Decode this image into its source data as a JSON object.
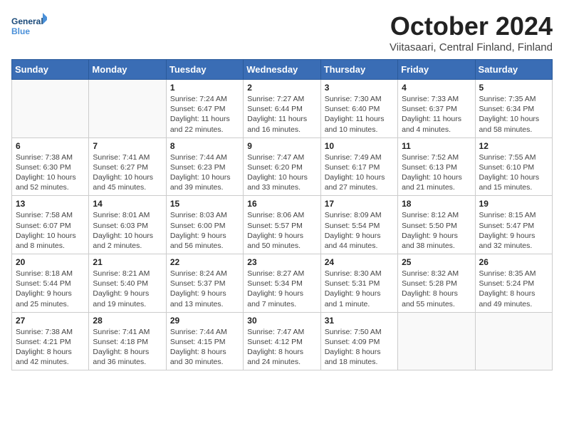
{
  "header": {
    "logo_general": "General",
    "logo_blue": "Blue",
    "month": "October 2024",
    "location": "Viitasaari, Central Finland, Finland"
  },
  "weekdays": [
    "Sunday",
    "Monday",
    "Tuesday",
    "Wednesday",
    "Thursday",
    "Friday",
    "Saturday"
  ],
  "weeks": [
    [
      {
        "day": "",
        "detail": ""
      },
      {
        "day": "",
        "detail": ""
      },
      {
        "day": "1",
        "detail": "Sunrise: 7:24 AM\nSunset: 6:47 PM\nDaylight: 11 hours and 22 minutes."
      },
      {
        "day": "2",
        "detail": "Sunrise: 7:27 AM\nSunset: 6:44 PM\nDaylight: 11 hours and 16 minutes."
      },
      {
        "day": "3",
        "detail": "Sunrise: 7:30 AM\nSunset: 6:40 PM\nDaylight: 11 hours and 10 minutes."
      },
      {
        "day": "4",
        "detail": "Sunrise: 7:33 AM\nSunset: 6:37 PM\nDaylight: 11 hours and 4 minutes."
      },
      {
        "day": "5",
        "detail": "Sunrise: 7:35 AM\nSunset: 6:34 PM\nDaylight: 10 hours and 58 minutes."
      }
    ],
    [
      {
        "day": "6",
        "detail": "Sunrise: 7:38 AM\nSunset: 6:30 PM\nDaylight: 10 hours and 52 minutes."
      },
      {
        "day": "7",
        "detail": "Sunrise: 7:41 AM\nSunset: 6:27 PM\nDaylight: 10 hours and 45 minutes."
      },
      {
        "day": "8",
        "detail": "Sunrise: 7:44 AM\nSunset: 6:23 PM\nDaylight: 10 hours and 39 minutes."
      },
      {
        "day": "9",
        "detail": "Sunrise: 7:47 AM\nSunset: 6:20 PM\nDaylight: 10 hours and 33 minutes."
      },
      {
        "day": "10",
        "detail": "Sunrise: 7:49 AM\nSunset: 6:17 PM\nDaylight: 10 hours and 27 minutes."
      },
      {
        "day": "11",
        "detail": "Sunrise: 7:52 AM\nSunset: 6:13 PM\nDaylight: 10 hours and 21 minutes."
      },
      {
        "day": "12",
        "detail": "Sunrise: 7:55 AM\nSunset: 6:10 PM\nDaylight: 10 hours and 15 minutes."
      }
    ],
    [
      {
        "day": "13",
        "detail": "Sunrise: 7:58 AM\nSunset: 6:07 PM\nDaylight: 10 hours and 8 minutes."
      },
      {
        "day": "14",
        "detail": "Sunrise: 8:01 AM\nSunset: 6:03 PM\nDaylight: 10 hours and 2 minutes."
      },
      {
        "day": "15",
        "detail": "Sunrise: 8:03 AM\nSunset: 6:00 PM\nDaylight: 9 hours and 56 minutes."
      },
      {
        "day": "16",
        "detail": "Sunrise: 8:06 AM\nSunset: 5:57 PM\nDaylight: 9 hours and 50 minutes."
      },
      {
        "day": "17",
        "detail": "Sunrise: 8:09 AM\nSunset: 5:54 PM\nDaylight: 9 hours and 44 minutes."
      },
      {
        "day": "18",
        "detail": "Sunrise: 8:12 AM\nSunset: 5:50 PM\nDaylight: 9 hours and 38 minutes."
      },
      {
        "day": "19",
        "detail": "Sunrise: 8:15 AM\nSunset: 5:47 PM\nDaylight: 9 hours and 32 minutes."
      }
    ],
    [
      {
        "day": "20",
        "detail": "Sunrise: 8:18 AM\nSunset: 5:44 PM\nDaylight: 9 hours and 25 minutes."
      },
      {
        "day": "21",
        "detail": "Sunrise: 8:21 AM\nSunset: 5:40 PM\nDaylight: 9 hours and 19 minutes."
      },
      {
        "day": "22",
        "detail": "Sunrise: 8:24 AM\nSunset: 5:37 PM\nDaylight: 9 hours and 13 minutes."
      },
      {
        "day": "23",
        "detail": "Sunrise: 8:27 AM\nSunset: 5:34 PM\nDaylight: 9 hours and 7 minutes."
      },
      {
        "day": "24",
        "detail": "Sunrise: 8:30 AM\nSunset: 5:31 PM\nDaylight: 9 hours and 1 minute."
      },
      {
        "day": "25",
        "detail": "Sunrise: 8:32 AM\nSunset: 5:28 PM\nDaylight: 8 hours and 55 minutes."
      },
      {
        "day": "26",
        "detail": "Sunrise: 8:35 AM\nSunset: 5:24 PM\nDaylight: 8 hours and 49 minutes."
      }
    ],
    [
      {
        "day": "27",
        "detail": "Sunrise: 7:38 AM\nSunset: 4:21 PM\nDaylight: 8 hours and 42 minutes."
      },
      {
        "day": "28",
        "detail": "Sunrise: 7:41 AM\nSunset: 4:18 PM\nDaylight: 8 hours and 36 minutes."
      },
      {
        "day": "29",
        "detail": "Sunrise: 7:44 AM\nSunset: 4:15 PM\nDaylight: 8 hours and 30 minutes."
      },
      {
        "day": "30",
        "detail": "Sunrise: 7:47 AM\nSunset: 4:12 PM\nDaylight: 8 hours and 24 minutes."
      },
      {
        "day": "31",
        "detail": "Sunrise: 7:50 AM\nSunset: 4:09 PM\nDaylight: 8 hours and 18 minutes."
      },
      {
        "day": "",
        "detail": ""
      },
      {
        "day": "",
        "detail": ""
      }
    ]
  ]
}
